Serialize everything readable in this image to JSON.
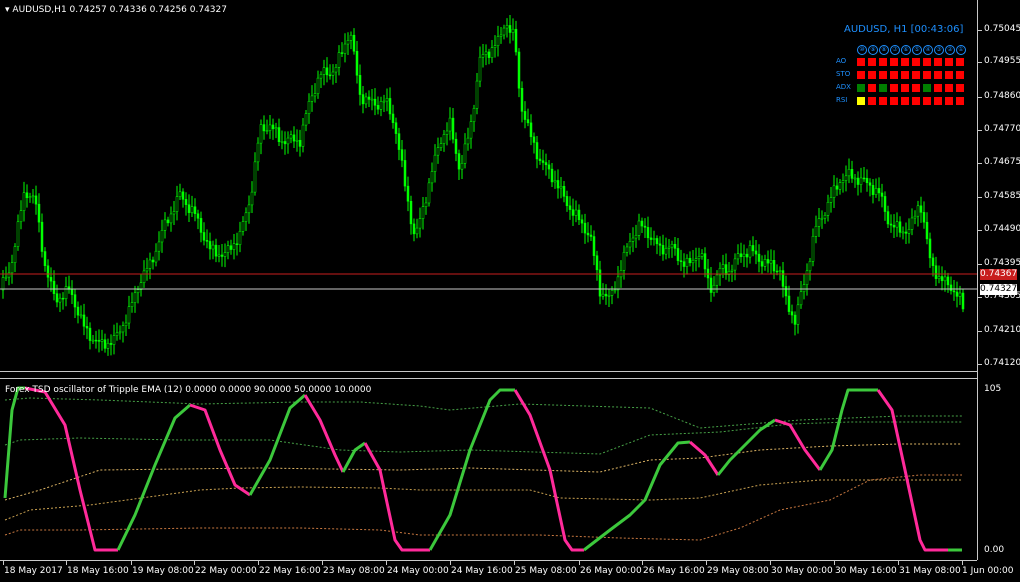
{
  "chart": {
    "symbol": "AUDUSD,H1",
    "ohlc": "0.74257 0.74336 0.74256 0.74327",
    "title": "AUDUSD,H1  0.74257 0.74336 0.74256 0.74327"
  },
  "price_axis": {
    "labels": [
      "0.75045",
      "0.74955",
      "0.74860",
      "0.74770",
      "0.74675",
      "0.74585",
      "0.74490",
      "0.74395",
      "0.74305",
      "0.74210",
      "0.74120"
    ],
    "current_red": "0.74367",
    "current_white": "0.74327"
  },
  "indicator": {
    "title": "Forex TSD oscillator of Tripple EMA (12) 0.0000 0.0000 90.0000 50.0000 10.0000",
    "scale_top": "105",
    "scale_bottom": "0.00",
    "colors": {
      "up": "#3cc83c",
      "down": "#ff2a9a",
      "levels": "#c8a050",
      "bands": "#46a046"
    }
  },
  "time_axis": {
    "labels": [
      "18 May 2017",
      "18 May 16:00",
      "19 May 08:00",
      "22 May 00:00",
      "22 May 16:00",
      "23 May 08:00",
      "24 May 00:00",
      "24 May 16:00",
      "25 May 08:00",
      "26 May 00:00",
      "26 May 16:00",
      "29 May 08:00",
      "30 May 00:00",
      "30 May 16:00",
      "31 May 08:00",
      "1 Jun 00:00"
    ]
  },
  "signal_panel": {
    "title": "AUDUSD, H1 [00:43:06]",
    "timeframes": [
      "⑩",
      "⑨",
      "⑧",
      "⑦",
      "⑥",
      "⑤",
      "④",
      "③",
      "②",
      "①"
    ],
    "rows": [
      {
        "label": "AO",
        "cells": [
          "red",
          "red",
          "red",
          "red",
          "red",
          "red",
          "red",
          "red",
          "red",
          "red"
        ]
      },
      {
        "label": "STO",
        "cells": [
          "red",
          "red",
          "red",
          "red",
          "red",
          "red",
          "red",
          "red",
          "red",
          "red"
        ]
      },
      {
        "label": "ADX",
        "cells": [
          "green",
          "red",
          "green",
          "red",
          "red",
          "red",
          "green",
          "red",
          "red",
          "red"
        ]
      },
      {
        "label": "RSI",
        "cells": [
          "yellow",
          "red",
          "red",
          "red",
          "red",
          "red",
          "red",
          "red",
          "red",
          "red"
        ]
      }
    ]
  },
  "colors": {
    "candle": "#00ff00",
    "grid": "#c8c8c8",
    "bid_line": "#c81e1e",
    "accent": "#1e90ff"
  }
}
